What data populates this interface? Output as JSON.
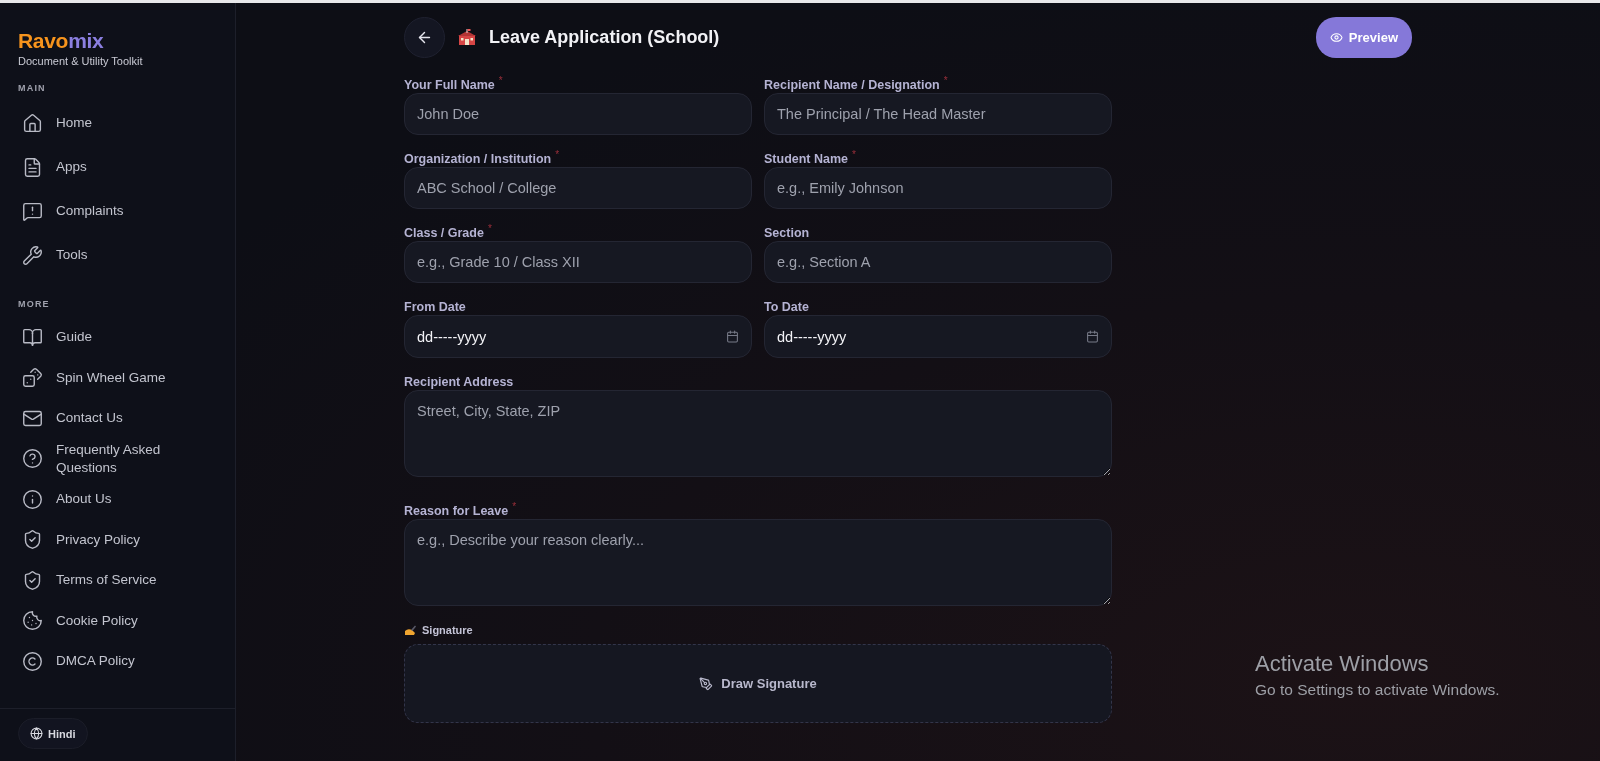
{
  "brand": {
    "name_part_1": "Ravo",
    "name_part_2": "mix",
    "tagline": "Document & Utility Toolkit"
  },
  "sidebar": {
    "sections": [
      {
        "title": "MAIN",
        "items": [
          {
            "label": "Home"
          },
          {
            "label": "Apps"
          },
          {
            "label": "Complaints"
          },
          {
            "label": "Tools"
          }
        ]
      },
      {
        "title": "MORE",
        "items": [
          {
            "label": "Guide"
          },
          {
            "label": "Spin Wheel Game"
          },
          {
            "label": "Contact Us"
          },
          {
            "label": "Frequently Asked Questions"
          },
          {
            "label": "About Us"
          },
          {
            "label": "Privacy Policy"
          },
          {
            "label": "Terms of Service"
          },
          {
            "label": "Cookie Policy"
          },
          {
            "label": "DMCA Policy"
          }
        ]
      }
    ],
    "language_button": "Hindi"
  },
  "header": {
    "title": "Leave Application (School)",
    "preview_button": "Preview"
  },
  "form": {
    "rows": [
      [
        {
          "kind": "text",
          "label": "Your Full Name",
          "required_mark": "*",
          "placeholder": "John Doe"
        },
        {
          "kind": "text",
          "label": "Recipient Name / Designation",
          "required_mark": "*",
          "placeholder": "The Principal / The Head Master"
        }
      ],
      [
        {
          "kind": "text",
          "label": "Organization / Institution",
          "required_mark": "*",
          "placeholder": "ABC School / College"
        },
        {
          "kind": "text",
          "label": "Student Name",
          "required_mark": "*",
          "placeholder": "e.g., Emily Johnson"
        }
      ],
      [
        {
          "kind": "text",
          "label": "Class / Grade",
          "required_mark": "*",
          "placeholder": "e.g., Grade 10 / Class XII"
        },
        {
          "kind": "text",
          "label": "Section",
          "placeholder": "e.g., Section A"
        }
      ],
      [
        {
          "kind": "date",
          "label": "From Date",
          "value": "dd-----yyyy"
        },
        {
          "kind": "date",
          "label": "To Date",
          "value": "dd-----yyyy"
        }
      ],
      [
        {
          "kind": "textarea",
          "label": "Recipient Address",
          "placeholder": "Street, City, State, ZIP"
        }
      ],
      [
        {
          "kind": "textarea",
          "label": "Reason for Leave",
          "required_mark": "*",
          "placeholder": "e.g., Describe your reason clearly..."
        }
      ]
    ],
    "signature": {
      "label": "Signature",
      "button": "Draw Signature"
    }
  },
  "activation_notice": {
    "title": "Activate Windows",
    "subtitle": "Go to Settings to activate Windows."
  }
}
